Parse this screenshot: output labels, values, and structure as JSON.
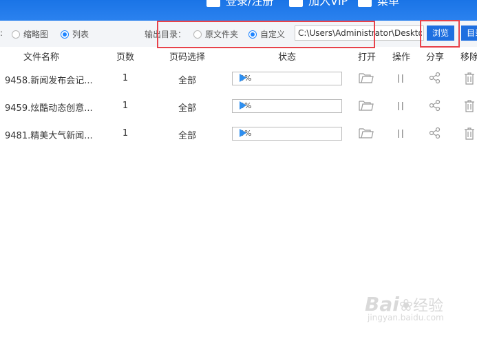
{
  "header": {
    "buttons": [
      {
        "label": "登录/注册",
        "icon": "user-icon"
      },
      {
        "label": "加入VIP",
        "icon": "vip-icon"
      },
      {
        "label": "菜单",
        "icon": "menu-icon"
      }
    ]
  },
  "toolbar": {
    "view_colon": ":",
    "view_thumbnail": "缩略图",
    "view_list": "列表",
    "view_selected": "列表",
    "output_label": "输出目录：",
    "output_original": "原文件夹",
    "output_custom": "自定义",
    "output_selected": "自定义",
    "path_value": "C:\\Users\\Administrator\\Desktop",
    "browse_label": "浏览",
    "open_dir_label": "目录"
  },
  "table": {
    "columns": [
      "文件名称",
      "页数",
      "页码选择",
      "状态",
      "打开",
      "操作",
      "分享",
      "移除"
    ],
    "rows": [
      {
        "name": "9458.新闻发布会记...",
        "pages": "1",
        "range": "全部",
        "progress": "0%"
      },
      {
        "name": "9459.炫酷动态创意...",
        "pages": "1",
        "range": "全部",
        "progress": "0%"
      },
      {
        "name": "9481.精美大气新闻...",
        "pages": "1",
        "range": "全部",
        "progress": "0%"
      }
    ]
  },
  "watermark": {
    "brand": "Bai",
    "brand2": "经验",
    "url": "jingyan.baidu.com"
  },
  "colors": {
    "accent": "#1e6fe0",
    "header": "#1a74e6",
    "highlight": "#e8424a",
    "play": "#2e8ff0"
  }
}
